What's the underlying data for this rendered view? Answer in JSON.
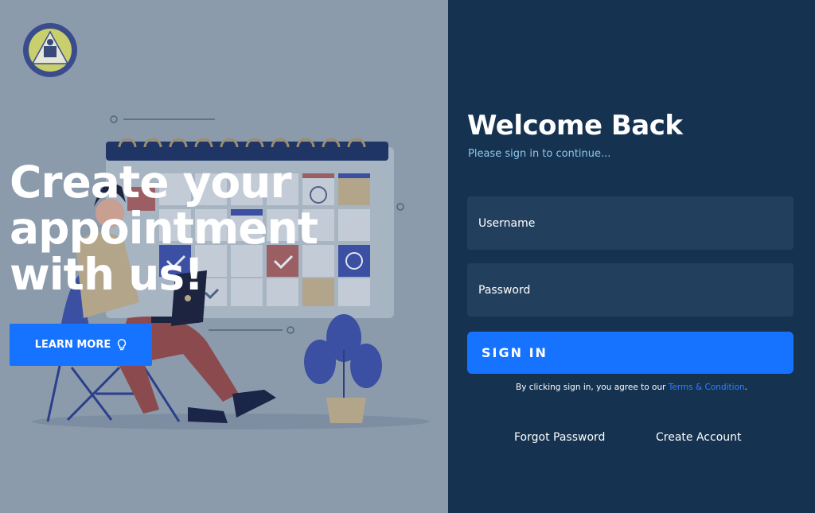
{
  "hero": {
    "title": "Create your appointment with us!",
    "learn_more_label": "LEARN MORE"
  },
  "login": {
    "title": "Welcome Back",
    "subtitle": "Please sign in to continue...",
    "username_placeholder": "Username",
    "password_placeholder": "Password",
    "sign_in_label": "SIGN IN",
    "agreement_prefix": "By clicking sign in, you agree to our ",
    "terms_link": "Terms & Condition",
    "agreement_suffix": ".",
    "forgot_password": "Forgot Password",
    "create_account": "Create Account"
  },
  "colors": {
    "left_panel": "#8b9bac",
    "right_panel": "#153250",
    "input_bg": "#22405d",
    "accent": "#1673ff",
    "subtitle": "#8ec8ee"
  },
  "icons": {
    "logo": "school-seal-logo",
    "learn_more": "lightbulb-icon"
  }
}
